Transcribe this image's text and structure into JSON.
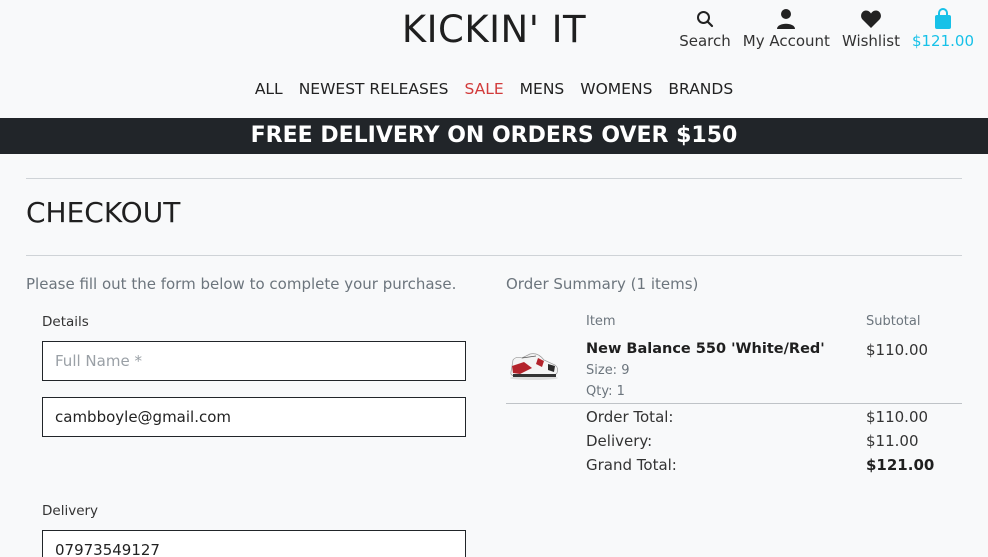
{
  "header": {
    "brand": "KICKIN' IT",
    "search_label": "Search",
    "account_label": "My Account",
    "wishlist_label": "Wishlist",
    "cart_total": "$121.00",
    "accent_color": "#17c1e8"
  },
  "nav": {
    "items": [
      "ALL",
      "NEWEST RELEASES",
      "SALE",
      "MENS",
      "WOMENS",
      "BRANDS"
    ],
    "sale_color": "#d23b3b"
  },
  "banner": {
    "text": "FREE DELIVERY ON ORDERS OVER $150"
  },
  "checkout": {
    "title": "CHECKOUT",
    "intro": "Please fill out the form below to complete your purchase.",
    "details_label": "Details",
    "full_name_placeholder": "Full Name *",
    "email_value": "cambboyle@gmail.com",
    "delivery_label": "Delivery",
    "phone_value": "07973549127"
  },
  "summary": {
    "title": "Order Summary (1 items)",
    "col_item": "Item",
    "col_subtotal": "Subtotal",
    "item": {
      "name": "New Balance 550 'White/Red'",
      "size": "Size: 9",
      "qty": "Qty: 1",
      "subtotal": "$110.00"
    },
    "order_total_label": "Order Total:",
    "order_total": "$110.00",
    "delivery_label": "Delivery:",
    "delivery": "$11.00",
    "grand_total_label": "Grand Total:",
    "grand_total": "$121.00"
  }
}
